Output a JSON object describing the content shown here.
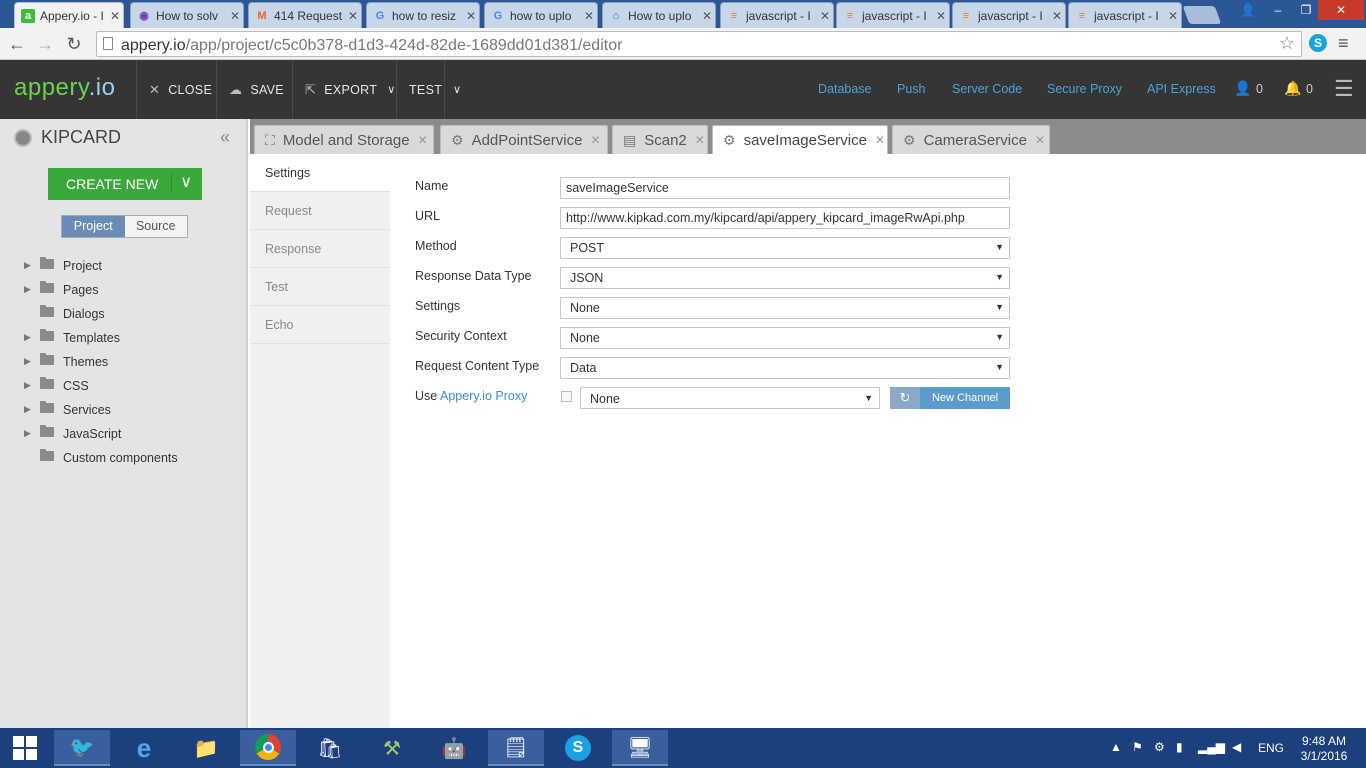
{
  "browser": {
    "tabs": [
      {
        "title": "Appery.io - I",
        "active": true
      },
      {
        "title": "How to solv",
        "active": false
      },
      {
        "title": "414 Request",
        "active": false
      },
      {
        "title": "how to resiz",
        "active": false
      },
      {
        "title": "how to uplo",
        "active": false
      },
      {
        "title": "How to uplo",
        "active": false
      },
      {
        "title": "javascript - I",
        "active": false
      },
      {
        "title": "javascript - I",
        "active": false
      },
      {
        "title": "javascript - I",
        "active": false
      },
      {
        "title": "javascript - I",
        "active": false
      }
    ],
    "url_host": "appery.io",
    "url_path": "/app/project/c5c0b378-d1d3-424d-82de-1689dd01d381/editor"
  },
  "header": {
    "logo_main": "appery",
    "logo_io": ".io",
    "close_label": "CLOSE",
    "save_label": "SAVE",
    "export_label": "EXPORT",
    "test_label": "TEST",
    "links": [
      "Database",
      "Push",
      "Server Code",
      "Secure Proxy",
      "API Express"
    ],
    "user_count": "0",
    "notification_count": "0"
  },
  "sidebar": {
    "project_name": "KIPCARD",
    "create_new": "CREATE NEW",
    "seg_project": "Project",
    "seg_source": "Source",
    "tree": [
      {
        "label": "Project",
        "arrow": true
      },
      {
        "label": "Pages",
        "arrow": true
      },
      {
        "label": "Dialogs",
        "arrow": false
      },
      {
        "label": "Templates",
        "arrow": true
      },
      {
        "label": "Themes",
        "arrow": true
      },
      {
        "label": "CSS",
        "arrow": true
      },
      {
        "label": "Services",
        "arrow": true
      },
      {
        "label": "JavaScript",
        "arrow": true
      },
      {
        "label": "Custom components",
        "arrow": false
      }
    ]
  },
  "editor_tabs": [
    {
      "label": "Model and Storage",
      "icon": "model-icon",
      "active": false
    },
    {
      "label": "AddPointService",
      "icon": "gear-icon",
      "active": false
    },
    {
      "label": "Scan2",
      "icon": "page-icon",
      "active": false
    },
    {
      "label": "saveImageService",
      "icon": "gear-icon",
      "active": true
    },
    {
      "label": "CameraService",
      "icon": "gear-icon",
      "active": false
    }
  ],
  "service_menu": [
    "Settings",
    "Request",
    "Response",
    "Test",
    "Echo"
  ],
  "form": {
    "name_label": "Name",
    "name_value": "saveImageService",
    "url_label": "URL",
    "url_value": "http://www.kipkad.com.my/kipcard/api/appery_kipcard_imageRwApi.php",
    "method_label": "Method",
    "method_value": "POST",
    "rdt_label": "Response Data Type",
    "rdt_value": "JSON",
    "settings_label": "Settings",
    "settings_value": "None",
    "security_label": "Security Context",
    "security_value": "None",
    "rct_label": "Request Content Type",
    "rct_value": "Data",
    "proxy_label_prefix": "Use ",
    "proxy_label_link": "Appery.io Proxy",
    "proxy_value": "None",
    "new_channel": "New Channel"
  },
  "taskbar": {
    "lang": "ENG",
    "time": "9:48 AM",
    "date": "3/1/2016"
  }
}
